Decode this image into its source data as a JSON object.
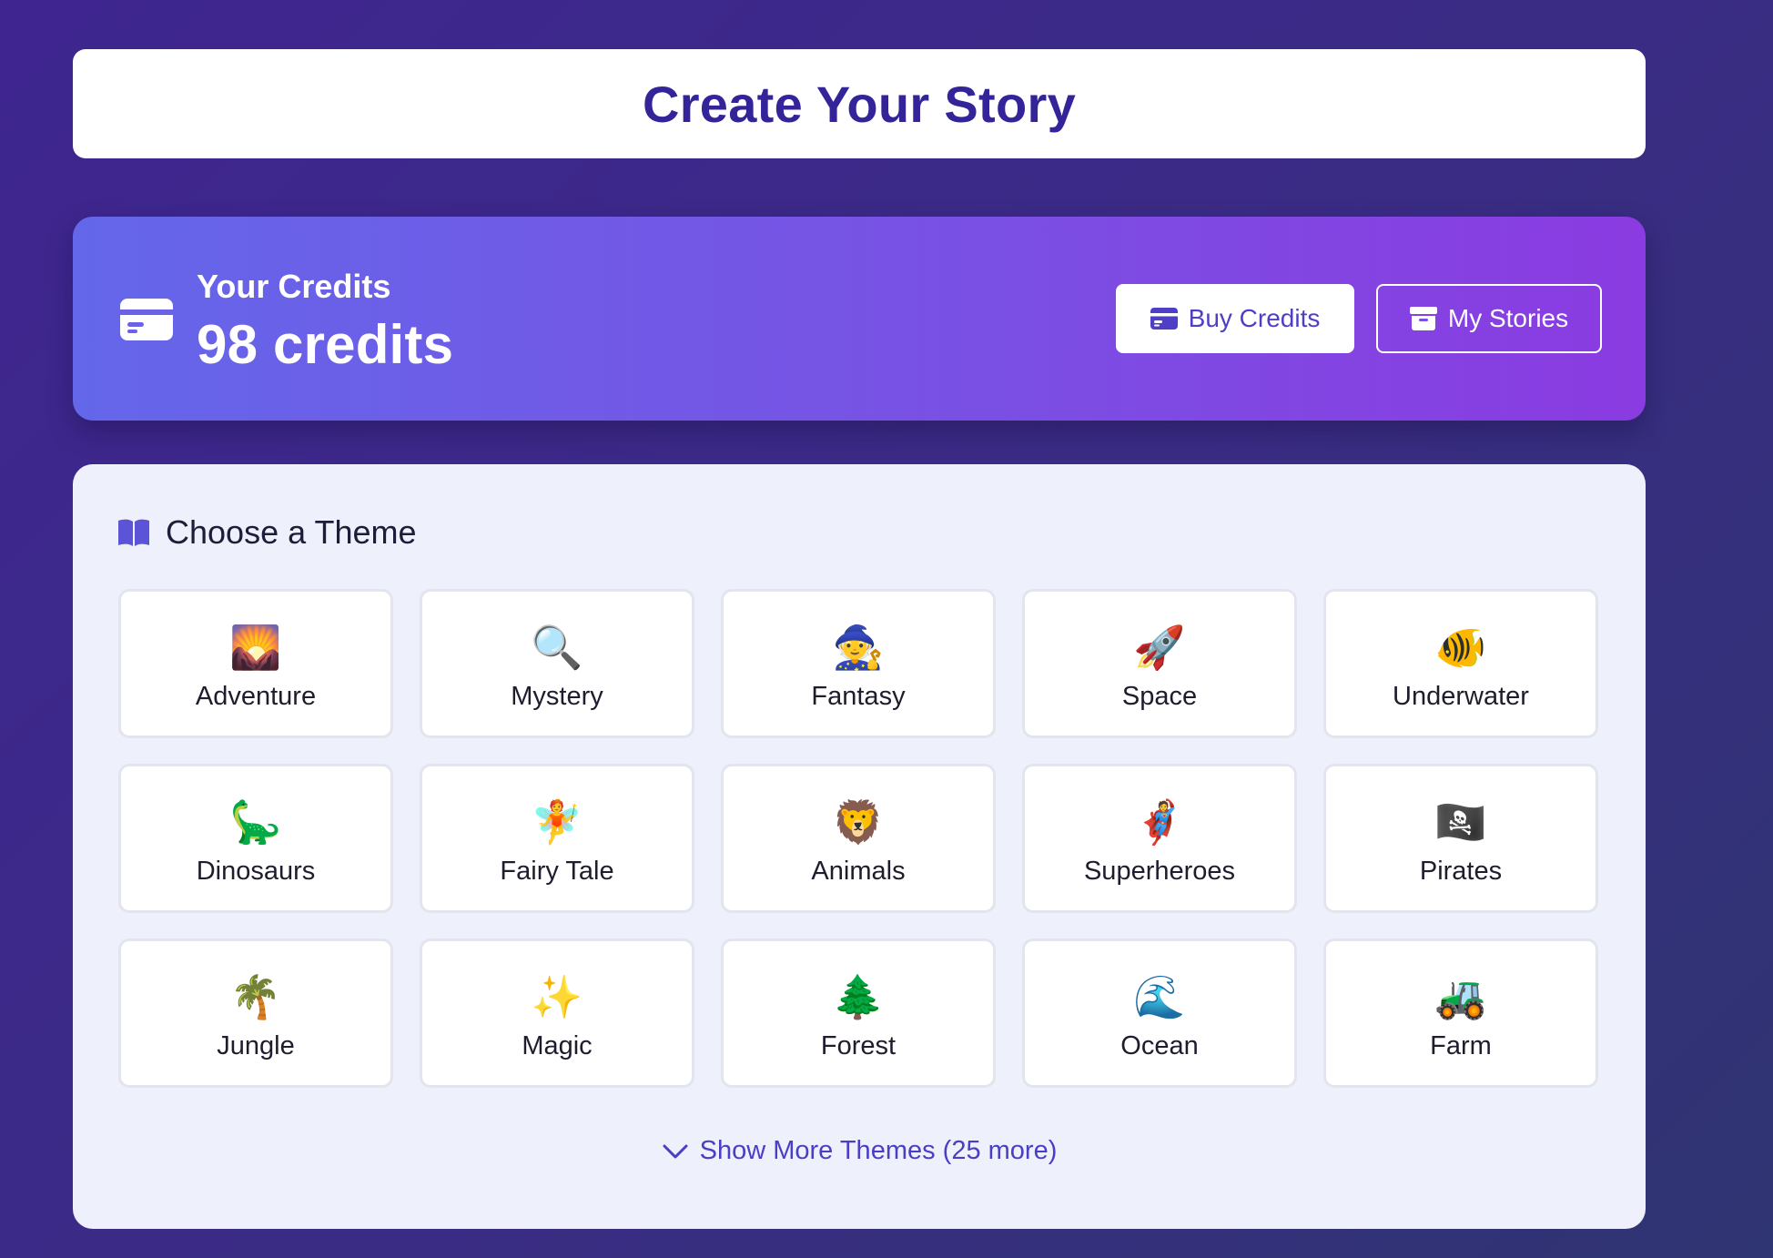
{
  "header": {
    "title": "Create Your Story"
  },
  "credits": {
    "label": "Your Credits",
    "value": "98 credits",
    "icon": "credit-card-icon",
    "buy_button": {
      "label": "Buy Credits",
      "icon": "credit-card-icon"
    },
    "stories_button": {
      "label": "My Stories",
      "icon": "archive-box-icon"
    }
  },
  "themes": {
    "section_title": "Choose a Theme",
    "section_icon": "open-book-icon",
    "items": [
      {
        "emoji": "🌄",
        "label": "Adventure"
      },
      {
        "emoji": "🔍",
        "label": "Mystery"
      },
      {
        "emoji": "🧙",
        "label": "Fantasy"
      },
      {
        "emoji": "🚀",
        "label": "Space"
      },
      {
        "emoji": "🐠",
        "label": "Underwater"
      },
      {
        "emoji": "🦕",
        "label": "Dinosaurs"
      },
      {
        "emoji": "🧚",
        "label": "Fairy Tale"
      },
      {
        "emoji": "🦁",
        "label": "Animals"
      },
      {
        "emoji": "🦸",
        "label": "Superheroes"
      },
      {
        "emoji": "🏴‍☠️",
        "label": "Pirates"
      },
      {
        "emoji": "🌴",
        "label": "Jungle"
      },
      {
        "emoji": "✨",
        "label": "Magic"
      },
      {
        "emoji": "🌲",
        "label": "Forest"
      },
      {
        "emoji": "🌊",
        "label": "Ocean"
      },
      {
        "emoji": "🚜",
        "label": "Farm"
      }
    ],
    "show_more_label": "Show More Themes (25 more)"
  },
  "colors": {
    "accent": "#4f3fc6",
    "title": "#34249a",
    "gradient_start": "#6467ea",
    "gradient_end": "#8a3be1"
  }
}
